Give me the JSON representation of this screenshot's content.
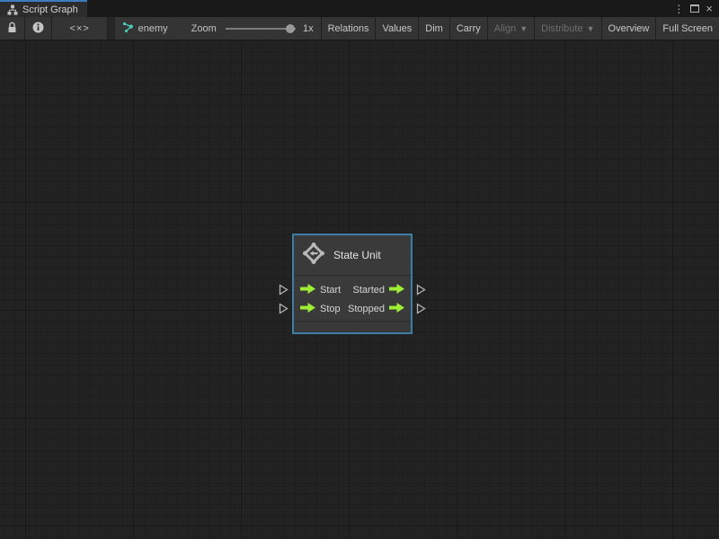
{
  "tab_bar": {
    "title": "Script Graph",
    "controls": {
      "kebab": "⋮",
      "close": "×"
    }
  },
  "toolbar": {
    "code_glyph": "<×>",
    "graph_name": "enemy",
    "zoom_label": "Zoom",
    "zoom_value": "1x",
    "dropdown_arrow": "▼",
    "buttons": [
      {
        "label": "Relations",
        "enabled": true
      },
      {
        "label": "Values",
        "enabled": true
      },
      {
        "label": "Dim",
        "enabled": true
      },
      {
        "label": "Carry",
        "enabled": true
      },
      {
        "label": "Align",
        "enabled": false,
        "dropdown": true
      },
      {
        "label": "Distribute",
        "enabled": false,
        "dropdown": true
      },
      {
        "label": "Overview",
        "enabled": true
      },
      {
        "label": "Full Screen",
        "enabled": true
      }
    ]
  },
  "node": {
    "title": "State Unit",
    "ports": [
      {
        "input": "Start",
        "output": "Started"
      },
      {
        "input": "Stop",
        "output": "Stopped"
      }
    ]
  },
  "colors": {
    "canvas_bg": "#222222",
    "grid_major_line": "#191919",
    "grid_minor_line": "#1e1e1e",
    "node_bg": "#3a3a3a",
    "selection_border": "#3d7ea6",
    "flow_port_green": "#9dee34",
    "tab_accent_blue": "#3e7cc0",
    "breadcrumb_icon_teal": "#4ecab8"
  }
}
